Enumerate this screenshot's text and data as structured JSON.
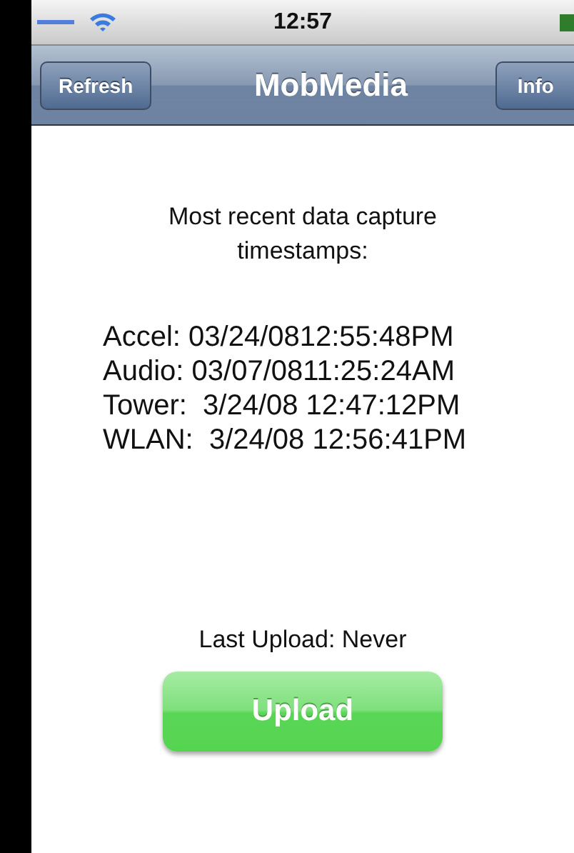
{
  "status_bar": {
    "time": "12:57"
  },
  "nav_bar": {
    "left_button": "Refresh",
    "title": "MobMedia",
    "right_button": "Info"
  },
  "heading": "Most recent data capture timestamps:",
  "timestamps": [
    "Accel: 03/24/0812:55:48PM",
    "Audio: 03/07/0811:25:24AM",
    "Tower:  3/24/08 12:47:12PM",
    "WLAN:  3/24/08 12:56:41PM"
  ],
  "last_upload": "Last Upload: Never",
  "upload_button": "Upload"
}
